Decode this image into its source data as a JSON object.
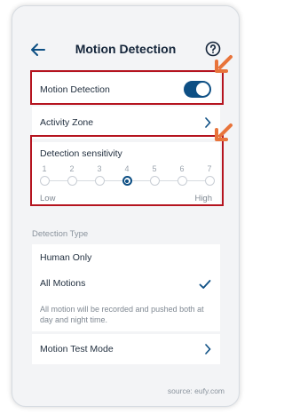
{
  "header": {
    "title": "Motion Detection"
  },
  "motion_detection": {
    "label": "Motion Detection",
    "enabled": true
  },
  "activity_zone": {
    "label": "Activity Zone"
  },
  "sensitivity": {
    "label": "Detection sensitivity",
    "levels": [
      "1",
      "2",
      "3",
      "4",
      "5",
      "6",
      "7"
    ],
    "selected": "4",
    "low_label": "Low",
    "high_label": "High"
  },
  "detection_type": {
    "section_title": "Detection Type",
    "options": [
      {
        "label": "Human Only",
        "selected": false
      },
      {
        "label": "All Motions",
        "selected": true
      }
    ],
    "description": "All motion will be recorded and pushed both at day and night time."
  },
  "motion_test": {
    "label": "Motion Test Mode"
  },
  "source_text": "source: eufy.com",
  "colors": {
    "accent": "#0d4f84",
    "highlight": "#b5141f",
    "arrow": "#e8743b"
  }
}
